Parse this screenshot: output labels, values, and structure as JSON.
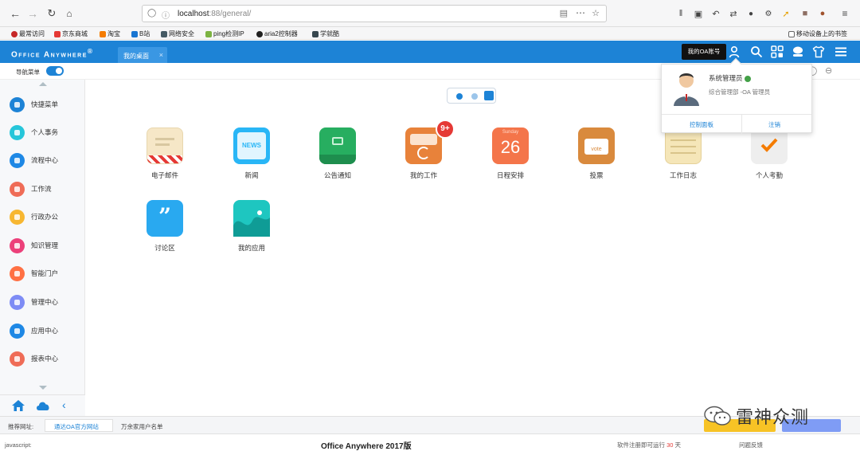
{
  "browser": {
    "url_host": "localhost",
    "url_path": ":88/general/",
    "bookmarks": [
      "最常访问",
      "京东商城",
      "淘宝",
      "B站",
      "网络安全",
      "ping检测IP",
      "aria2控制器",
      "学就酷"
    ],
    "mobile_bookmarks": "移动设备上的书签",
    "bookmark_colors": [
      "#c62828",
      "#e53935",
      "#f57c00",
      "#1976d2",
      "#455a64",
      "#7cb342",
      "#212121",
      "#37474f"
    ]
  },
  "app": {
    "brand": "Office Anywhere",
    "brand_mark": "®",
    "active_tab": "我的桌面",
    "tab_close": "×",
    "oa_tooltip": "我的OA账号",
    "accent": "#1d83d6"
  },
  "subbar": {
    "nav_toggle_label": "导航菜单"
  },
  "sidebar": {
    "items": [
      {
        "label": "快捷菜单",
        "color": "#1d83d6"
      },
      {
        "label": "个人事务",
        "color": "#26c6da"
      },
      {
        "label": "流程中心",
        "color": "#1e88e5"
      },
      {
        "label": "工作流",
        "color": "#ef6c57"
      },
      {
        "label": "行政办公",
        "color": "#f7b731"
      },
      {
        "label": "知识管理",
        "color": "#ec407a"
      },
      {
        "label": "智能门户",
        "color": "#ff7043"
      },
      {
        "label": "管理中心",
        "color": "#7e8cf5"
      },
      {
        "label": "应用中心",
        "color": "#1e88e5"
      },
      {
        "label": "报表中心",
        "color": "#ef6c57"
      }
    ]
  },
  "apps": [
    {
      "label": "电子邮件",
      "color": "#f6e7c7"
    },
    {
      "label": "新闻",
      "color": "#29b6f6",
      "icon_text": "NEWS"
    },
    {
      "label": "公告通知",
      "color": "#27ae60"
    },
    {
      "label": "我的工作",
      "color": "#e8823a",
      "badge": "9+"
    },
    {
      "label": "日程安排",
      "color": "#f4754a",
      "icon_text": "26",
      "icon_sub": "Sunday"
    },
    {
      "label": "投票",
      "color": "#d98a3d",
      "icon_text": "vote"
    },
    {
      "label": "工作日志",
      "color": "#f5e6b8"
    },
    {
      "label": "个人考勤",
      "color": "#eeeeee"
    },
    {
      "label": "讨论区",
      "color": "#29a9f0",
      "icon_text": "”"
    },
    {
      "label": "我的应用",
      "color": "#1ec6c0"
    }
  ],
  "user_popup": {
    "name": "系统管理员",
    "dept": "综合管理部 -OA 管理员",
    "control_panel": "控制面板",
    "logout": "注销",
    "online_color": "#43a047"
  },
  "footer": {
    "recommend_label": "推荐网址:",
    "official_site": "通达OA官方网站",
    "users_list": "万余家用户名单"
  },
  "status": {
    "left": "javascript:",
    "center": "Office Anywhere 2017版",
    "trial_prefix": "软件注册即可运行",
    "trial_days": "30",
    "trial_suffix": "天",
    "feedback": "问题反馈"
  },
  "watermark": {
    "text": "雷神众测"
  }
}
